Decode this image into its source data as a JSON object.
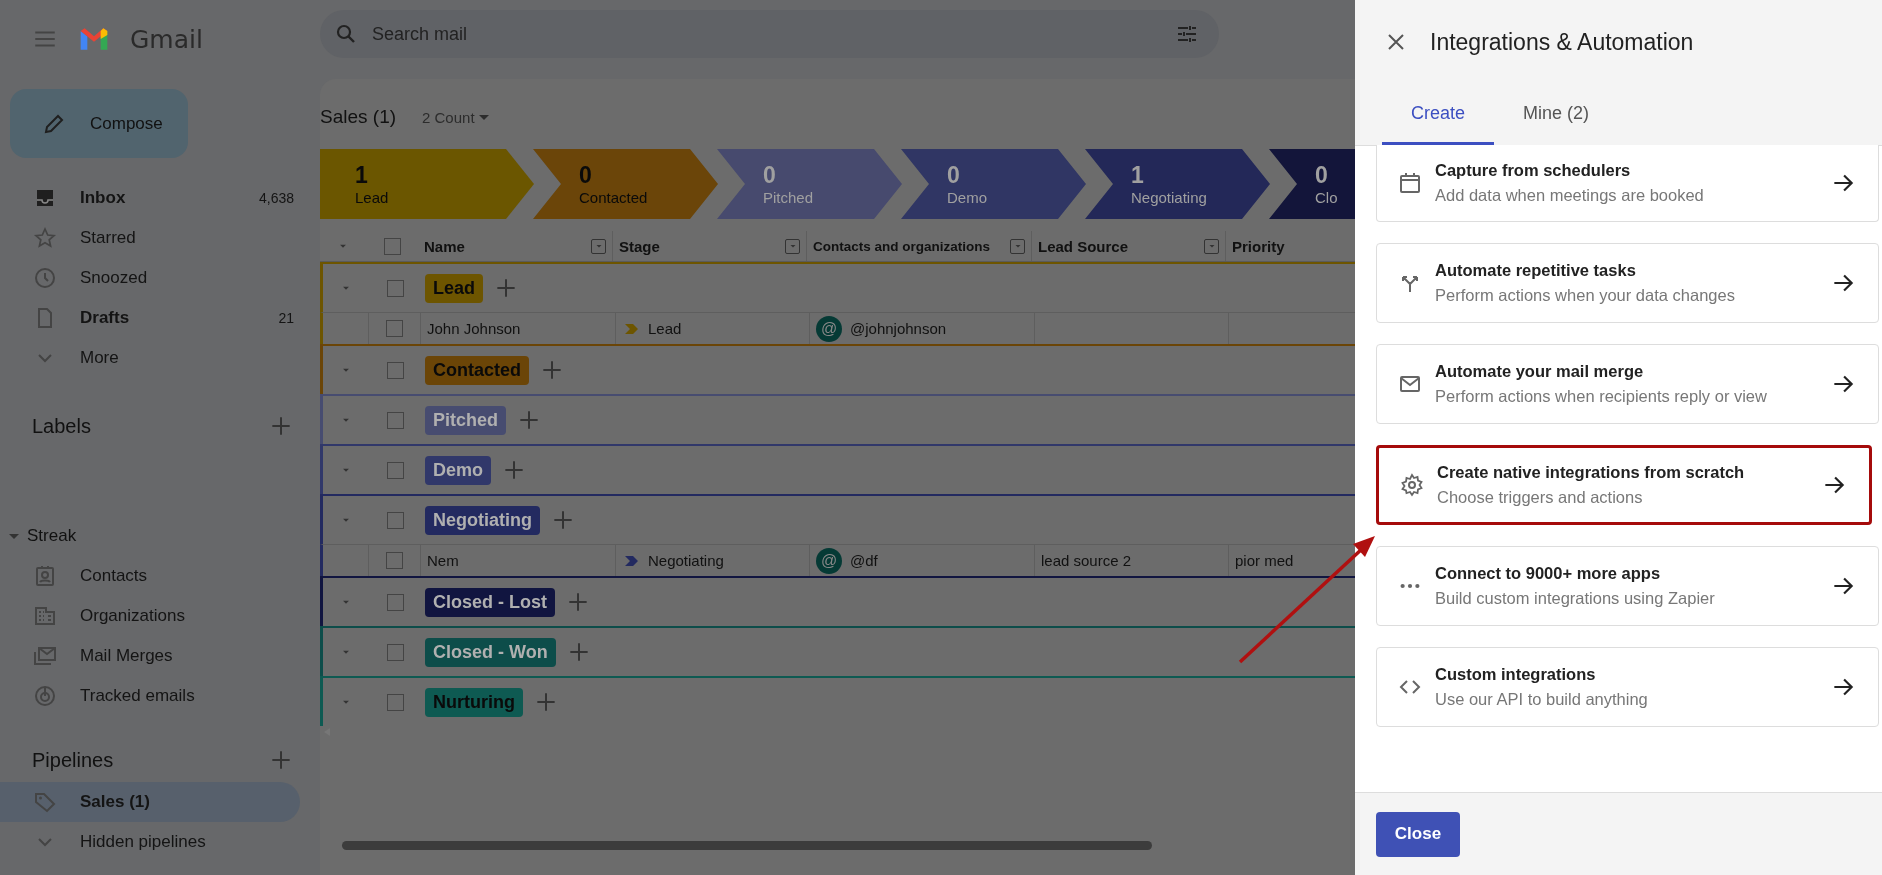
{
  "app": {
    "name": "Gmail"
  },
  "compose": "Compose",
  "mail_nav": [
    {
      "label": "Inbox",
      "count": "4,638",
      "bold": true,
      "kind": "inbox"
    },
    {
      "label": "Starred",
      "bold": false,
      "kind": "star"
    },
    {
      "label": "Snoozed",
      "bold": false,
      "kind": "clock"
    },
    {
      "label": "Drafts",
      "count": "21",
      "bold": true,
      "kind": "file"
    },
    {
      "label": "More",
      "bold": false,
      "kind": "chevron"
    }
  ],
  "labels": {
    "title": "Labels"
  },
  "streak": {
    "title": "Streak",
    "expanded": true,
    "items": [
      {
        "label": "Contacts",
        "kind": "contact"
      },
      {
        "label": "Organizations",
        "kind": "building"
      },
      {
        "label": "Mail Merges",
        "kind": "mails"
      },
      {
        "label": "Tracked emails",
        "kind": "tracked"
      }
    ]
  },
  "pipelines": {
    "title": "Pipelines",
    "items": [
      {
        "label": "Sales (1)",
        "selected": true,
        "kind": "tag"
      },
      {
        "label": "Hidden pipelines",
        "selected": false,
        "kind": "chevron"
      }
    ]
  },
  "search": {
    "placeholder": "Search mail"
  },
  "pipeline": {
    "title": "Sales (1)",
    "count_menu": "2 Count"
  },
  "stages": [
    {
      "count": "1",
      "name": "Lead",
      "color": "#6b5600"
    },
    {
      "count": "0",
      "name": "Contacted",
      "color": "#6b4509"
    },
    {
      "count": "0",
      "name": "Pitched",
      "color": "#474a6e"
    },
    {
      "count": "0",
      "name": "Demo",
      "color": "#303664"
    },
    {
      "count": "1",
      "name": "Negotiating",
      "color": "#232858"
    },
    {
      "count": "0",
      "name": "Clo",
      "color": "#13153a"
    }
  ],
  "table": {
    "checked": false,
    "columns": [
      {
        "label": "Name",
        "filter": true
      },
      {
        "label": "Stage",
        "filter": true
      },
      {
        "label": "Contacts and organizations",
        "filter": true
      },
      {
        "label": "Lead Source",
        "filter": true
      },
      {
        "label": "Priority"
      }
    ],
    "groups": [
      {
        "name": "Lead",
        "color": "#6d5500",
        "checked": false,
        "rows": [
          {
            "checked": false,
            "name": "John Johnson",
            "stage": "Lead",
            "avatar": "@",
            "contact": "@johnjohnson"
          }
        ]
      },
      {
        "name": "Contacted",
        "color": "#6b4507",
        "checked": false
      },
      {
        "name": "Pitched",
        "color": "#474c70",
        "checked": false
      },
      {
        "name": "Demo",
        "color": "#31386a",
        "checked": false
      },
      {
        "name": "Negotiating",
        "color": "#232a60",
        "checked": false,
        "rows": [
          {
            "checked": false,
            "name": "Nem",
            "stage": "Negotiating",
            "avatar": "@",
            "contact": "@df",
            "lead_source": "lead source 2",
            "priority": "pior med"
          }
        ]
      },
      {
        "name": "Closed - Lost",
        "color": "#111540",
        "checked": false
      },
      {
        "name": "Closed - Won",
        "color": "#0d4d4a",
        "checked": false
      },
      {
        "name": "Nurturing",
        "color": "#0e5a52",
        "checked": false
      }
    ]
  },
  "panel": {
    "title": "Integrations & Automation",
    "tabs": [
      {
        "label": "Create",
        "selected": true
      },
      {
        "label": "Mine (2)",
        "selected": false
      }
    ],
    "options": [
      {
        "title": "Capture from schedulers",
        "subtitle": "Add data when meetings are booked",
        "kind": "calendar",
        "highlighted": false
      },
      {
        "title": "Automate repetitive tasks",
        "subtitle": "Perform actions when your data changes",
        "kind": "split",
        "highlighted": false
      },
      {
        "title": "Automate your mail merge",
        "subtitle": "Perform actions when recipients reply or view",
        "kind": "mail",
        "highlighted": false
      },
      {
        "title": "Create native integrations from scratch",
        "subtitle": "Choose triggers and actions",
        "kind": "gear",
        "highlighted": true
      },
      {
        "title": "Connect to 9000+ more apps",
        "subtitle": "Build custom integrations using Zapier",
        "kind": "dots",
        "highlighted": false
      },
      {
        "title": "Custom integrations",
        "subtitle": "Use our API to build anything",
        "kind": "code",
        "highlighted": false
      }
    ],
    "close_button": "Close"
  }
}
